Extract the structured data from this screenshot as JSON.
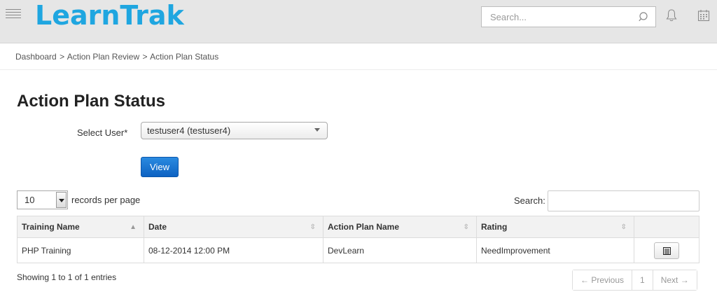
{
  "header": {
    "logo": "LearnTrak",
    "search_placeholder": "Search..."
  },
  "breadcrumb": {
    "items": [
      "Dashboard",
      "Action Plan Review",
      "Action Plan Status"
    ],
    "separator": ">"
  },
  "page_title": "Action Plan Status",
  "form": {
    "select_user_label": "Select User*",
    "selected_user": "testuser4 (testuser4)",
    "view_button": "View"
  },
  "table_controls": {
    "page_length": "10",
    "records_per_page": "records per page",
    "search_label": "Search:"
  },
  "table": {
    "columns": [
      "Training Name",
      "Date",
      "Action Plan Name",
      "Rating",
      ""
    ],
    "rows": [
      {
        "training_name": "PHP Training",
        "date": "08-12-2014 12:00 PM",
        "action_plan_name": "DevLearn",
        "rating": "NeedImprovement"
      }
    ]
  },
  "footer": {
    "info": "Showing 1 to 1 of 1 entries",
    "previous": "← Previous",
    "page": "1",
    "next": "Next →"
  },
  "colors": {
    "brand": "#1fa6e0",
    "primary_button": "#0d62c2",
    "header_bg": "#e6e6e6"
  }
}
